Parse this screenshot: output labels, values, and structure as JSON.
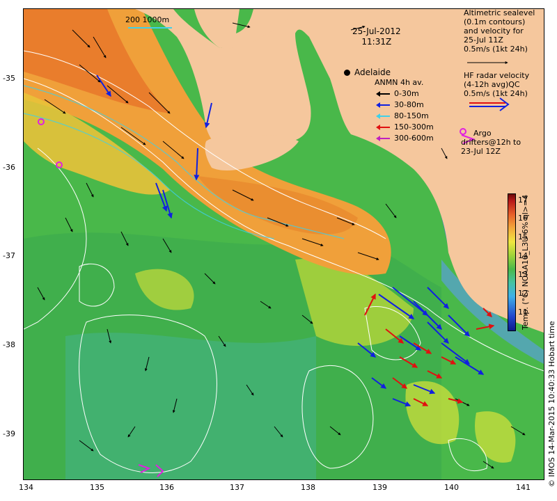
{
  "map": {
    "date": "25-Jul-2012",
    "time": "11:31Z",
    "city": "Adelaide",
    "scale_text": "200  1000m",
    "x_ticks": [
      "134",
      "135",
      "136",
      "137",
      "138",
      "139",
      "140",
      "141"
    ],
    "y_ticks": [
      "-35",
      "-36",
      "-37",
      "-38",
      "-39"
    ],
    "legend_sealevel": [
      "Altimetric sealevel",
      "(0.1m contours)",
      "and velocity for",
      "25-Jul 11Z",
      "0.5m/s (1kt 24h)"
    ],
    "legend_hf": [
      "HF radar velocity",
      "(4-12h avg)QC",
      "0.5m/s (1kt 24h)"
    ],
    "anmn_title": "ANMN 4h av.",
    "anmn_bins": [
      {
        "label": "0-30m",
        "color": "#000000"
      },
      {
        "label": "30-80m",
        "color": "#1020e0"
      },
      {
        "label": "80-150m",
        "color": "#3fd0e8"
      },
      {
        "label": "150-300m",
        "color": "#e01010"
      },
      {
        "label": "300-600m",
        "color": "#c020c0"
      }
    ],
    "argo": [
      "Argo",
      "drifters@12h to",
      "23-Jul 12Z"
    ],
    "colorbar_ticks": [
      "17",
      "16",
      "15",
      "14",
      "13",
      "12",
      "11"
    ],
    "colorbar_title": "Temp. (°C) NOAA16_L3U 6% ql>=4",
    "credit": "© IMOS 14-Mar-2015 10:40:33 Hobart time",
    "colors": {
      "land": "#f5c79d",
      "water_green": "#4bbf5a",
      "warm_orange": "#f0a03a",
      "radar_blue": "#1020e0",
      "radar_red": "#e01010",
      "argo_magenta": "#e020e0",
      "contour": "#ffffff",
      "cyan_track": "#3fd0e8"
    }
  }
}
